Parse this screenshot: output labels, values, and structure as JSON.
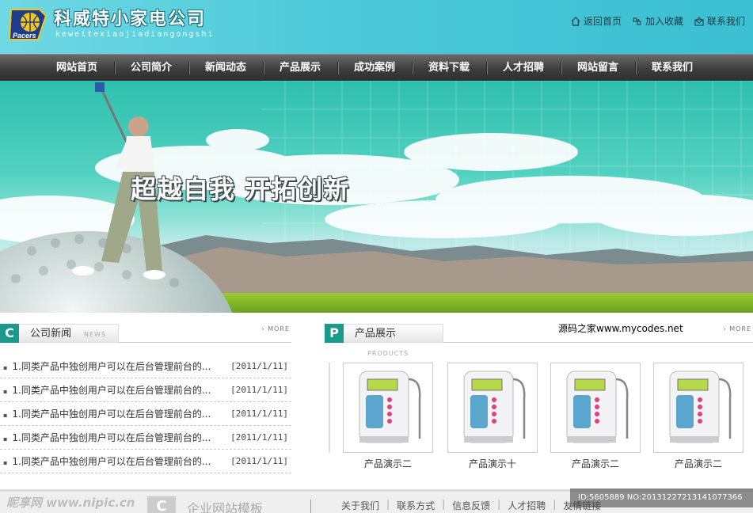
{
  "header": {
    "title": "科威特小家电公司",
    "subtitle": "keweitexiaojiadiangongshi",
    "logo_text": "Pacers",
    "links": [
      {
        "label": "返回首页",
        "icon": "home-icon"
      },
      {
        "label": "加入收藏",
        "icon": "bookmark-icon"
      },
      {
        "label": "联系我们",
        "icon": "contact-icon"
      }
    ]
  },
  "nav": [
    "网站首页",
    "公司简介",
    "新闻动态",
    "产品展示",
    "成功案例",
    "资料下载",
    "人才招聘",
    "网站留言",
    "联系我们"
  ],
  "banner": {
    "slogan": "超越自我 开拓创新"
  },
  "news": {
    "letter": "C",
    "title": "公司新闻",
    "title_en": "NEWS",
    "more": "MORE",
    "items": [
      {
        "title": "1.同类产品中独创用户可以在后台管理前台的...",
        "date": "[2011/1/11]"
      },
      {
        "title": "1.同类产品中独创用户可以在后台管理前台的...",
        "date": "[2011/1/11]"
      },
      {
        "title": "1.同类产品中独创用户可以在后台管理前台的...",
        "date": "[2011/1/11]"
      },
      {
        "title": "1.同类产品中独创用户可以在后台管理前台的...",
        "date": "[2011/1/11]"
      },
      {
        "title": "1.同类产品中独创用户可以在后台管理前台的...",
        "date": "[2011/1/11]"
      }
    ]
  },
  "products": {
    "letter": "P",
    "title": "产品展示",
    "title_en": "PRODUCTS",
    "more": "MORE",
    "site_text": "源码之家www.mycodes.net",
    "items": [
      {
        "caption": "产品演示二"
      },
      {
        "caption": "产品演示十"
      },
      {
        "caption": "产品演示二"
      },
      {
        "caption": "产品演示二"
      }
    ]
  },
  "footer": {
    "letter": "C",
    "template_text": "企业网站模板",
    "links": [
      "关于我们",
      "联系方式",
      "信息反馈",
      "人才招聘",
      "友情链接"
    ],
    "watermark_left": "昵享网 www.nipic.cn",
    "watermark_right": "ID:5605889 NO:20131227213141077366"
  }
}
